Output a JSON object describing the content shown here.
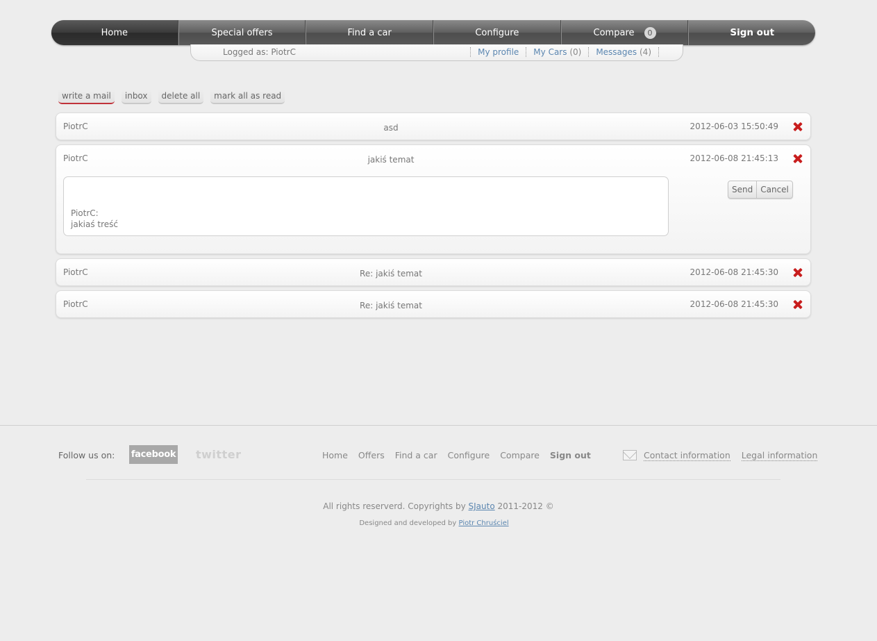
{
  "nav": {
    "items": [
      "Home",
      "Special offers",
      "Find a car",
      "Configure",
      "Compare",
      "Sign out"
    ],
    "compare_count": "0"
  },
  "subbar": {
    "logged_as": "Logged as: PiotrC",
    "my_profile": "My profile",
    "my_cars": "My Cars",
    "my_cars_count": "(0)",
    "messages": "Messages",
    "messages_count": "(4)"
  },
  "toolbar": {
    "write": "write a mail",
    "inbox": "inbox",
    "delete_all": "delete all",
    "mark_all": "mark all as read"
  },
  "messages": [
    {
      "from": "PiotrC",
      "subject": "asd",
      "date": "2012-06-03 15:50:49"
    },
    {
      "from": "PiotrC",
      "subject": "jakiś temat",
      "date": "2012-06-08 21:45:13"
    },
    {
      "from": "PiotrC",
      "subject": "Re: jakiś temat",
      "date": "2012-06-08 21:45:30"
    },
    {
      "from": "PiotrC",
      "subject": "Re: jakiś temat",
      "date": "2012-06-08 21:45:30"
    }
  ],
  "reply": {
    "line1": "PiotrC:",
    "line2": "jakiaś treść",
    "send": "Send",
    "cancel": "Cancel"
  },
  "footer": {
    "follow": "Follow us on:",
    "facebook": "facebook",
    "twitter": "twitter",
    "nav": [
      "Home",
      "Offers",
      "Find a car",
      "Configure",
      "Compare",
      "Sign out"
    ],
    "contact": "Contact information",
    "legal": "Legal information",
    "copyright_pre": "All rights reserverd. Copyrights by",
    "copyright_link": "SJauto",
    "copyright_post": "2011-2012 ©",
    "designed_pre": "Designed and developed by",
    "designed_link": "Piotr Chruściel"
  }
}
